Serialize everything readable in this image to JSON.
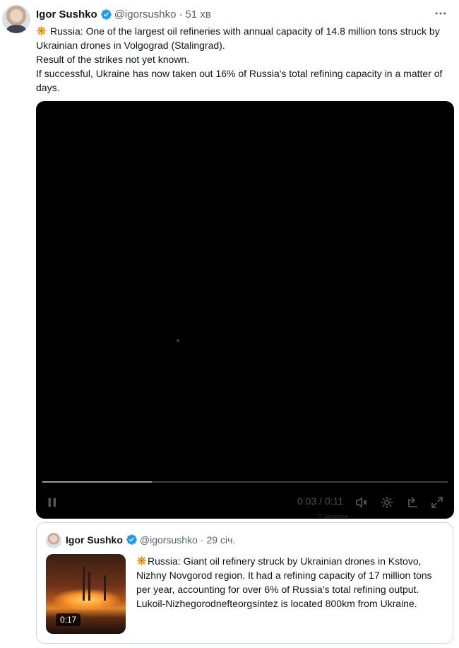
{
  "tweet": {
    "author_name": "Igor Sushko",
    "handle": "@igorsushko",
    "separator": "·",
    "time": "51 хв",
    "body": [
      "Russia: One of the largest oil refineries with annual capacity of 14.8 million tons struck by Ukrainian drones in Volgograd (Stalingrad).",
      "Result of the strikes not yet known.",
      "If successful, Ukraine has now taken out 16% of Russia's total refining capacity in a matter of days."
    ],
    "emoji": "collision-icon"
  },
  "video": {
    "time_readout": "0:03 / 0:11",
    "progress_fraction": 0.27,
    "caption_text": "ТГ Архиватор",
    "icons": [
      "pause-icon",
      "volume-icon",
      "settings-icon",
      "exit-pip-icon",
      "fullscreen-icon"
    ]
  },
  "quote": {
    "author_name": "Igor Sushko",
    "handle": "@igorsushko",
    "separator": "·",
    "time": "29 січ.",
    "duration": "0:17",
    "body": [
      "Russia: Giant oil refinery struck by Ukrainian drones in Kstovo, Nizhny Novgorod region. It had a refining capacity of 17 million tons per year, accounting for over 6% of Russia's total refining output.",
      "Lukoil-Nizhegorodnefteorgsintez is located 800km from Ukraine."
    ],
    "emoji": "collision-icon"
  },
  "colors": {
    "verified": "#1d9bf0",
    "muted_text": "#536471",
    "border": "#cfd9de"
  }
}
